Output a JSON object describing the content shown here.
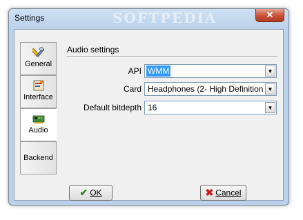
{
  "window": {
    "title": "Settings",
    "watermark": "SOFTPEDIA",
    "close_glyph": "✕"
  },
  "tabs": [
    {
      "label": "General",
      "icon": "tools-icon",
      "active": false
    },
    {
      "label": "Interface",
      "icon": "interface-icon",
      "active": false
    },
    {
      "label": "Audio",
      "icon": "sound-card-icon",
      "active": true
    },
    {
      "label": "Backend",
      "icon": "",
      "active": false
    }
  ],
  "audio": {
    "section_title": "Audio settings",
    "api_label": "API",
    "api_value": "WMM",
    "card_label": "Card",
    "card_value": "Headphones (2- High Definition",
    "bitdepth_label": "Default bitdepth",
    "bitdepth_value": "16"
  },
  "buttons": {
    "ok": "OK",
    "cancel": "Cancel"
  },
  "colors": {
    "window_frame": "#b9d1ea",
    "selection": "#3399ff",
    "close": "#c75035"
  }
}
